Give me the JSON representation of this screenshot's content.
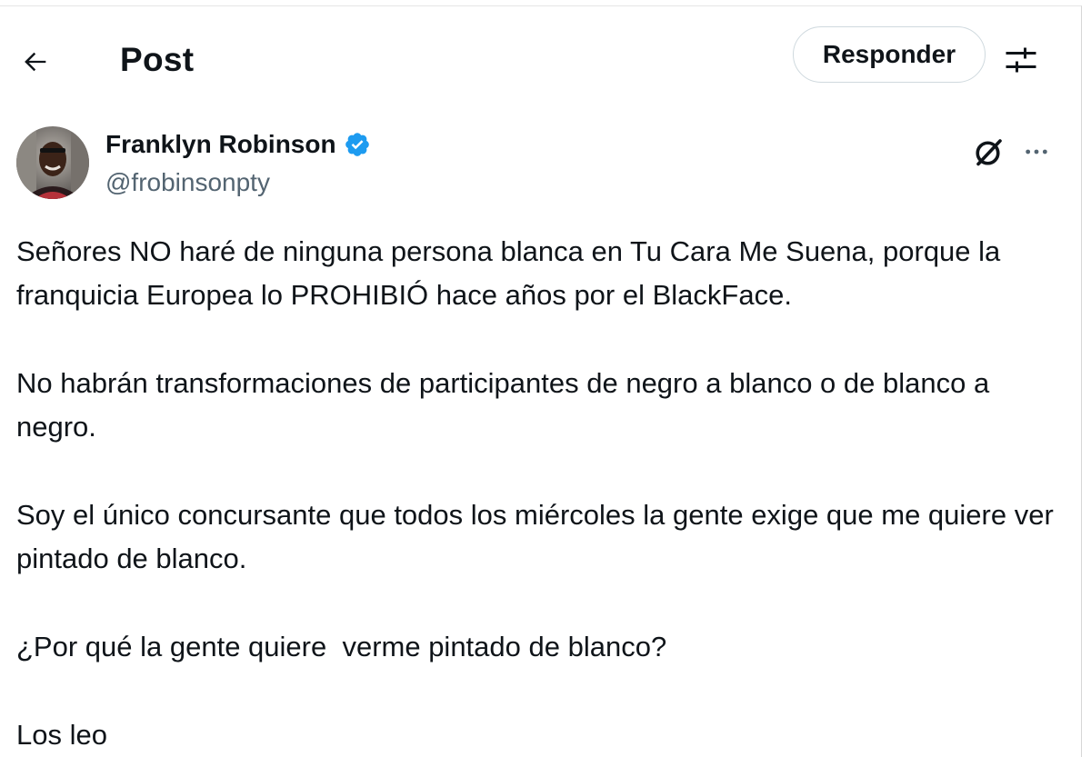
{
  "header": {
    "title": "Post",
    "reply_label": "Responder",
    "back_icon": "arrow-left-icon",
    "filter_icon": "sliders-icon"
  },
  "post": {
    "author_name": "Franklyn Robinson",
    "author_handle": "@frobinsonpty",
    "verified": true,
    "verified_color": "#1d9bf0",
    "paragraphs": [
      "Señores NO haré de ninguna persona blanca en Tu Cara Me Suena, porque la franquicia Europea lo PROHIBIÓ hace años por el BlackFace.",
      "No habrán transformaciones de participantes de negro a blanco o de blanco a negro.",
      "Soy el único concursante que todos los miércoles la gente exige que me quiere ver pintado de blanco.",
      "¿Por qué la gente quiere  verme pintado de blanco?",
      "Los leo"
    ]
  },
  "colors": {
    "text_primary": "#0f1419",
    "text_secondary": "#536471",
    "border": "#cfd9de",
    "accent": "#1d9bf0"
  }
}
